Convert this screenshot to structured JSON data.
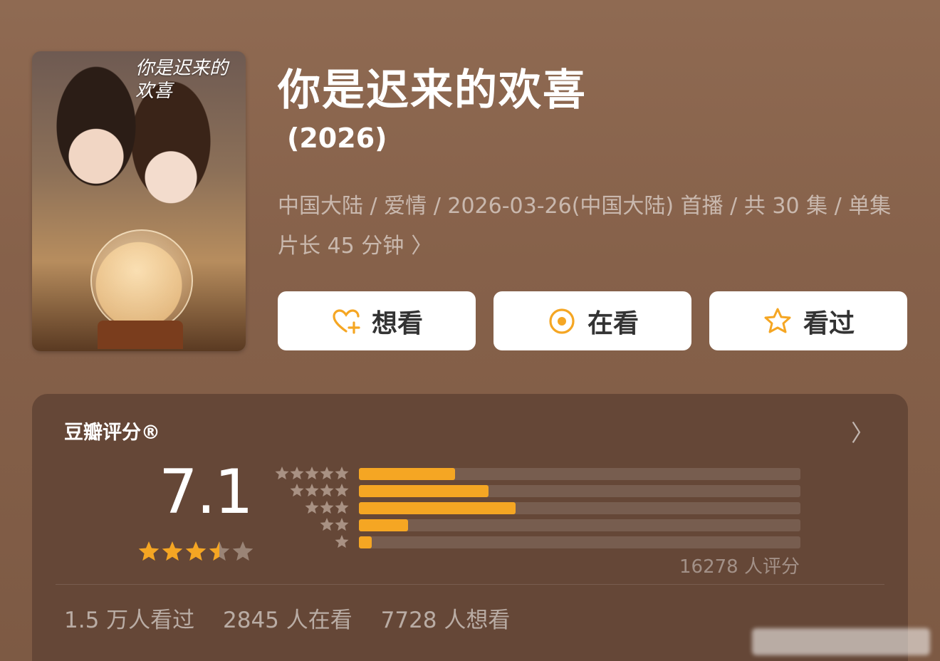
{
  "movie": {
    "title": "你是迟来的欢喜",
    "year": "(2026)",
    "meta": "中国大陆 / 爱情 / 2026-03-26(中国大陆) 首播 / 共 30 集 / 单集片长 45 分钟",
    "poster_title": "你是迟来的欢喜"
  },
  "actions": {
    "want": "想看",
    "watching": "在看",
    "watched": "看过"
  },
  "rating": {
    "heading": "豆瓣评分®",
    "score": "7.1",
    "stars_value": 3.5,
    "distribution": [
      {
        "stars": 5,
        "fraction": 0.217
      },
      {
        "stars": 4,
        "fraction": 0.293
      },
      {
        "stars": 3,
        "fraction": 0.355
      },
      {
        "stars": 2,
        "fraction": 0.112
      },
      {
        "stars": 1,
        "fraction": 0.029
      }
    ],
    "count": "16278 人评分"
  },
  "stats": {
    "watched": "1.5 万人看过",
    "watching": "2845 人在看",
    "want": "7728 人想看"
  },
  "colors": {
    "accent": "#f5a623",
    "card": "#654737"
  }
}
